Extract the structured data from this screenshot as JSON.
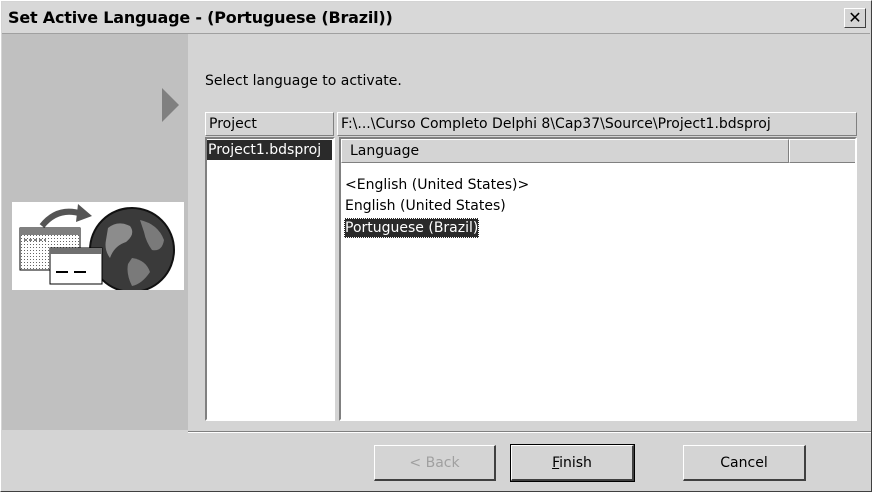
{
  "window": {
    "title": "Set Active Language - (Portuguese (Brazil))",
    "close_glyph": "✕"
  },
  "wizard": {
    "instruction": "Select language to activate."
  },
  "project_list": {
    "header": "Project",
    "items": [
      "Project1.bdsproj"
    ]
  },
  "path_header": "F:\\...\\Curso Completo Delphi 8\\Cap37\\Source\\Project1.bdsproj",
  "language_list": {
    "header": "Language",
    "items": [
      {
        "label": "<English (United States)>",
        "selected": false
      },
      {
        "label": "English (United States)",
        "selected": false
      },
      {
        "label": "Portuguese (Brazil)",
        "selected": true
      }
    ]
  },
  "buttons": {
    "back": "< Back",
    "finish": "Finish",
    "cancel": "Cancel"
  },
  "icons": {
    "wizard_arrow": "triangle-right-icon",
    "globe": "globe-windows-icon"
  },
  "colors": {
    "selection": "#2a2a2a",
    "face": "#d4d4d4"
  }
}
